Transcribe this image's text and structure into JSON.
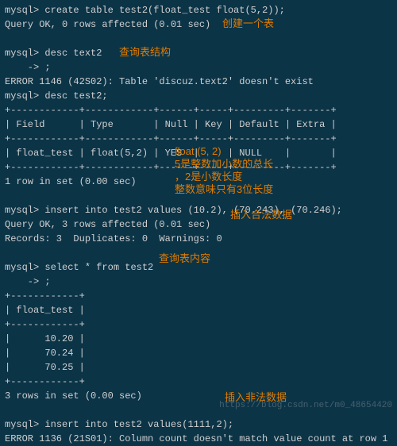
{
  "prompt": "mysql> ",
  "cont": "    -> ",
  "lines": {
    "l1": "create table test2(float_test float(5,2));",
    "l2": "Query OK, 0 rows affected (0.01 sec)",
    "l3": "",
    "l4": "desc text2",
    "l5": ";",
    "l6": "ERROR 1146 (42S02): Table 'discuz.text2' doesn't exist",
    "l7": "desc test2;",
    "sep1": "+------------+------------+------+-----+---------+-------+",
    "hdr": "| Field      | Type       | Null | Key | Default | Extra |",
    "row1": "| float_test | float(5,2) | YES  |     | NULL    |       |",
    "rowres1": "1 row in set (0.00 sec)",
    "l8": "",
    "l9": "insert into test2 values (10.2), (70.243), (70.246);",
    "l10": "Query OK, 3 rows affected (0.01 sec)",
    "l11": "Records: 3  Duplicates: 0  Warnings: 0",
    "l12": "",
    "l13": "select * from test2",
    "l14": ";",
    "sep2": "+------------+",
    "hdr2": "| float_test |",
    "v1": "|      10.20 |",
    "v2": "|      70.24 |",
    "v3": "|      70.25 |",
    "rowres2": "3 rows in set (0.00 sec)",
    "l15": "",
    "l16": "insert into test2 values(1111,2);",
    "l17": "ERROR 1136 (21S01): Column count doesn't match value count at row 1"
  },
  "annotations": {
    "a1": "创建一个表",
    "a2": "查询表结构",
    "a3_l1": "float (5, 2)",
    "a3_l2": "5是整数加小数的总长",
    "a3_l3": "，2是小数长度",
    "a3_l4": "整数意味只有3位长度",
    "a4": "插入合法数据",
    "a5": "查询表内容",
    "a6": "插入非法数据"
  },
  "watermark": "https://blog.csdn.net/m0_48654420"
}
